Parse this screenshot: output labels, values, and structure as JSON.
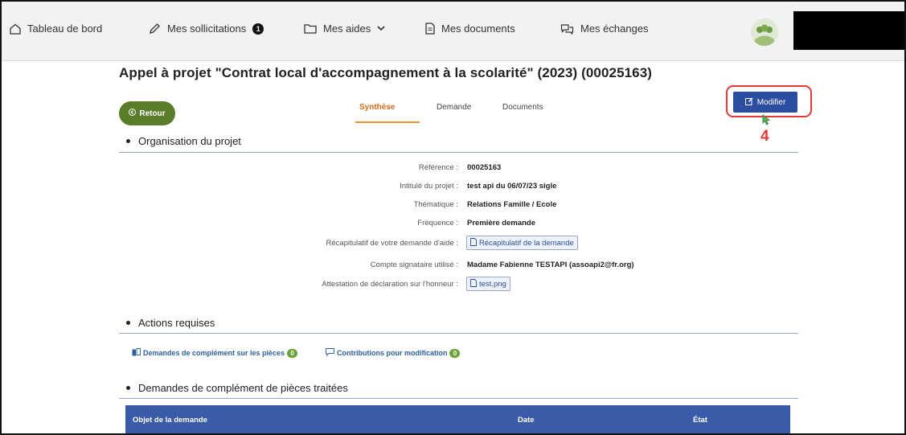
{
  "nav": {
    "dashboard": "Tableau de bord",
    "sollicitations": "Mes sollicitations",
    "sollicitations_badge": "1",
    "aides": "Mes aides",
    "documents": "Mes documents",
    "echanges": "Mes échanges"
  },
  "page": {
    "title": "Appel à projet \"Contrat local d'accompagnement à la scolarité\" (2023) (00025163)",
    "back_label": "Retour",
    "modify_label": "Modifier",
    "step_number": "4"
  },
  "tabs": [
    {
      "label": "Synthèse",
      "active": true
    },
    {
      "label": "Demande",
      "active": false
    },
    {
      "label": "Documents",
      "active": false
    }
  ],
  "organisation": {
    "heading": "Organisation du projet",
    "fields": [
      {
        "label": "Référence :",
        "value": "00025163"
      },
      {
        "label": "Intitulé du projet :",
        "value": "test api du 06/07/23 sigle"
      },
      {
        "label": "Thématique :",
        "value": "Relations Famille / Ecole"
      },
      {
        "label": "Fréquence :",
        "value": "Première demande"
      },
      {
        "label": "Récapitulatif de votre demande d'aide :",
        "value": "Récapitulatif de la demande"
      },
      {
        "label": "Compte signataire utilisé :",
        "value": "Madame Fabienne TESTAPI (assoapi2@fr.org)"
      },
      {
        "label": "Attestation de déclaration sur l'honneur :",
        "value": "test.png"
      }
    ]
  },
  "actions": {
    "heading": "Actions requises",
    "links": [
      {
        "label": "Demandes de complément sur les pièces",
        "count": "0"
      },
      {
        "label": "Contributions pour modification",
        "count": "0"
      }
    ]
  },
  "processed": {
    "heading": "Demandes de complément de pièces traitées",
    "columns": [
      "Objet de la demande",
      "Date",
      "État"
    ]
  },
  "colors": {
    "accent": "#2c4ea0",
    "retour": "#5a7d2c",
    "active_tab": "#d46a1a",
    "highlight": "#e53935",
    "table_header": "#3a5ba8"
  }
}
